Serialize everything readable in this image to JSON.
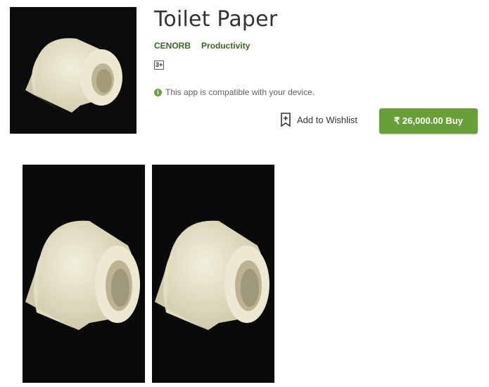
{
  "app": {
    "title": "Toilet Paper",
    "developer": "CENORB",
    "category": "Productivity",
    "content_rating": "3+",
    "compatibility": "This app is compatible with your device."
  },
  "actions": {
    "wishlist_label": "Add to Wishlist",
    "buy_label": "₹ 26,000.00 Buy"
  },
  "icons": {
    "info": "info-circle-icon",
    "wishlist": "bookmark-plus-icon"
  },
  "colors": {
    "accent_green": "#689f38",
    "link_green": "#33691e",
    "image_background": "#0b0b0b",
    "paper": "#e8e4cd"
  },
  "screenshots": [
    {
      "alt": "toilet paper roll screenshot 1"
    },
    {
      "alt": "toilet paper roll screenshot 2"
    }
  ]
}
